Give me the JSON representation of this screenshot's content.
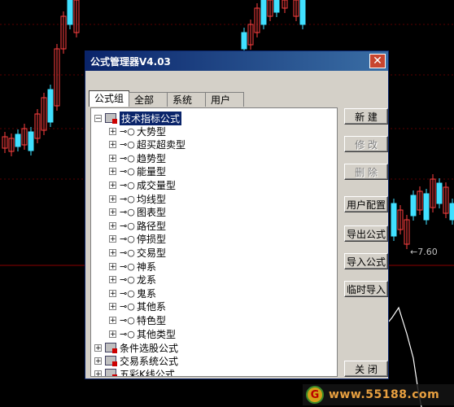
{
  "dialog": {
    "title": "公式管理器V4.03",
    "tabs": [
      "公式组",
      "全部",
      "系统",
      "用户"
    ],
    "buttons": {
      "new": "新  建",
      "modify": "修  改",
      "delete": "删  除",
      "user_config": "用户配置",
      "export": "导出公式",
      "import": "导入公式",
      "temp_import": "临时导入",
      "close": "关  闭"
    },
    "tree": {
      "root": "技术指标公式",
      "children": [
        "大势型",
        "超买超卖型",
        "趋势型",
        "能量型",
        "成交量型",
        "均线型",
        "图表型",
        "路径型",
        "停损型",
        "交易型",
        "神系",
        "龙系",
        "鬼系",
        "其他系",
        "特色型",
        "其他类型"
      ],
      "others": [
        "条件选股公式",
        "交易系统公式",
        "五彩K线公式"
      ]
    }
  },
  "chart": {
    "price_label": "←7.60"
  },
  "watermark": {
    "logo": "G",
    "text": "www.55188.com"
  }
}
